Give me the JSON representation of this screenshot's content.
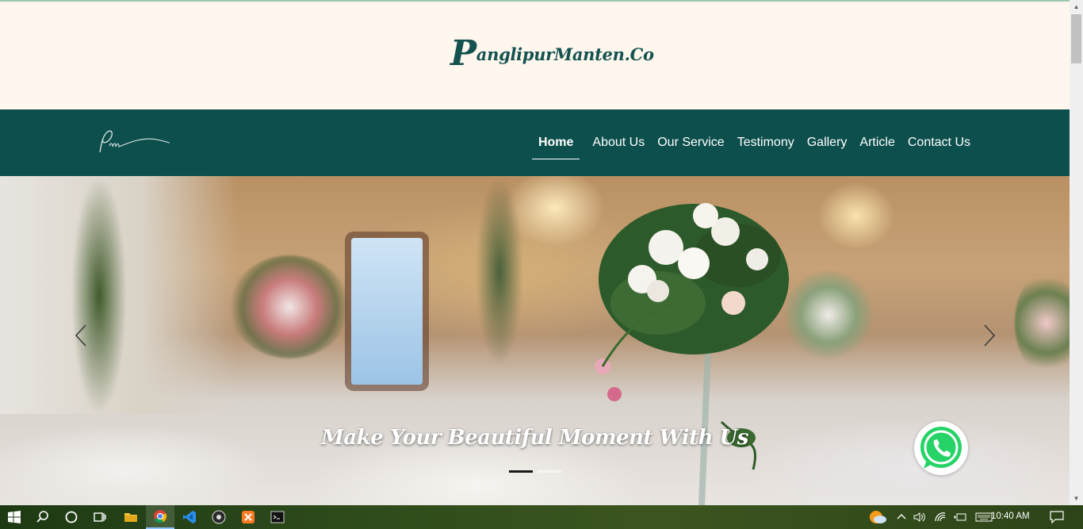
{
  "brand": {
    "initial": "P",
    "rest": "anglipurManten.Co"
  },
  "nav": {
    "items": [
      {
        "label": "Home",
        "active": true
      },
      {
        "label": "About Us"
      },
      {
        "label": "Our Service"
      },
      {
        "label": "Testimony"
      },
      {
        "label": "Gallery"
      },
      {
        "label": "Article"
      },
      {
        "label": "Contact Us"
      }
    ]
  },
  "hero": {
    "caption": "Make Your Beautiful Moment With Us",
    "slides_total": 2,
    "active_slide": 1
  },
  "taskbar": {
    "apps": [
      "windows-start",
      "search",
      "cortana",
      "task-view",
      "file-explorer",
      "chrome",
      "vscode",
      "obs",
      "xampp",
      "terminal"
    ],
    "active_app": "chrome",
    "clock": "10:40 AM"
  },
  "colors": {
    "brand_bar": "#fff7ee",
    "navbar": "#0c4f4c",
    "brand_text": "#14524f",
    "whatsapp": "#25d366"
  }
}
